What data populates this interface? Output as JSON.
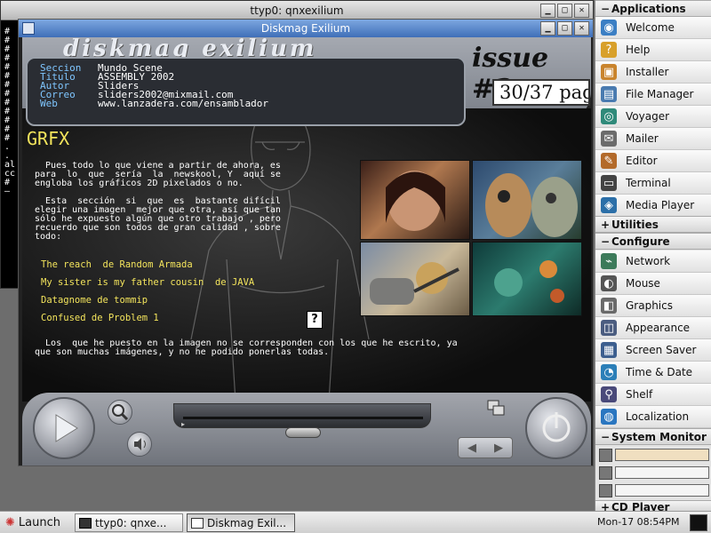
{
  "terminal": {
    "title": "ttyp0: qnxexilium",
    "left_chars": [
      "#",
      "#",
      "#",
      "#",
      "#",
      "#",
      "#",
      "#",
      "#",
      "#",
      "#",
      "#",
      "#",
      ".",
      ".",
      "al",
      "cc",
      "#",
      "–"
    ]
  },
  "diskmag": {
    "title": "Diskmag Exilium",
    "logo": "diskmag exilium",
    "issue": "issue #2",
    "page": "30/37 pag",
    "info": [
      {
        "key": "Seccion",
        "value": "Mundo Scene"
      },
      {
        "key": "Titulo",
        "value": "ASSEMBLY 2002"
      },
      {
        "key": "Autor",
        "value": "Sliders"
      },
      {
        "key": "Correo",
        "value": "sliders2002@mixmail.com"
      },
      {
        "key": "Web",
        "value": "www.lanzadera.com/ensamblador"
      }
    ],
    "heading": "GRFX",
    "para1": "  Pues todo lo que viene a partir de ahora, es\npara  lo  que  sería  la  newskool, Y  aquí se\nengloba los gráficos 2D pixelados o no.",
    "para2": "  Esta  sección  si  que  es  bastante difícil\nelegir una imagen  mejor que otra, así que tan\nsólo he expuesto algún que otro trabajo , pero\nrecuerdo que son todos de gran calidad , sobre\ntodo:",
    "links": [
      "The reach  de Random Armada",
      "My sister is my father cousin  de JAVA",
      "Datagnome de tommip",
      "Confused de Problem 1"
    ],
    "para3": "  Los  que he puesto en la imagen no se corresponden con los que he escrito, ya\nque son muchas imágenes, y no he podido ponerlas todas."
  },
  "panel": {
    "applications": "Applications",
    "app_items": [
      "Welcome",
      "Help",
      "Installer",
      "File Manager",
      "Voyager",
      "Mailer",
      "Editor",
      "Terminal",
      "Media Player"
    ],
    "utilities": "Utilities",
    "configure": "Configure",
    "config_items": [
      "Network",
      "Mouse",
      "Graphics",
      "Appearance",
      "Screen Saver",
      "Time & Date",
      "Shelf",
      "Localization"
    ],
    "system_monitor": "System Monitor",
    "cd_player": "CD Player"
  },
  "taskbar": {
    "launch": "Launch",
    "tasks": [
      "ttyp0: qnxe...",
      "Diskmag Exil..."
    ],
    "clock": "Mon-17 08:54PM"
  },
  "colors": {
    "link": "#f3e45c",
    "info_key": "#7fc6ff",
    "titlebar_active": "#3f6fb8"
  }
}
